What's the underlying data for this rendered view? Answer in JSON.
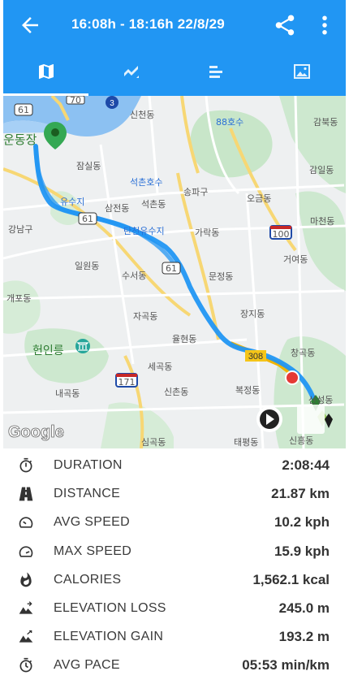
{
  "header": {
    "title": "16:08h - 18:16h  22/8/29",
    "icons": [
      "arrow-back-icon",
      "share-icon",
      "more-vert-icon"
    ]
  },
  "tabs": [
    {
      "icon": "map-icon",
      "active": true
    },
    {
      "icon": "chart-icon",
      "active": false
    },
    {
      "icon": "bars-icon",
      "active": false
    },
    {
      "icon": "photo-icon",
      "active": false
    }
  ],
  "map": {
    "labels": {
      "sincheon": "신천동",
      "lake88": "88호수",
      "gamun": "감북동",
      "undong": "운동장",
      "jamsil": "잠실동",
      "seokchon_lake": "석촌호수",
      "gamil": "감일동",
      "songpa": "송파구",
      "yusuji": "유수지",
      "samjeon": "삼전동",
      "seokchon": "석촌동",
      "ogeum": "오금동",
      "gangnam": "강남구",
      "tanjeon_yusuji": "탄천유수지",
      "garak": "가락동",
      "macheon": "마천동",
      "ilwon": "일원동",
      "suseo": "수서동",
      "geoyeo": "거여동",
      "munjeong": "문정동",
      "gaepo": "개포동",
      "jangji": "장지동",
      "jagok": "자곡동",
      "yulhyeon": "율현동",
      "heoninneung": "헌인릉",
      "changgok": "창곡동",
      "segok": "세곡동",
      "naegok": "내곡동",
      "sinchon": "신촌동",
      "bokjeong": "복정동",
      "sanseong": "산성동",
      "simgok": "심곡동",
      "taepyeong": "태평동",
      "sinheung": "신흥동",
      "shield_3": "3",
      "shield_70": "70",
      "shield_61a": "61",
      "shield_61b": "61",
      "shield_61c": "61",
      "shield_100": "100",
      "shield_308": "308",
      "shield_171": "171",
      "google": "Google"
    },
    "colors": {
      "route": "#2196f3",
      "end_marker": "#e53935",
      "start_pin": "#34a853"
    }
  },
  "stats": [
    {
      "icon": "stopwatch-icon",
      "label": "DURATION",
      "value": "2:08:44"
    },
    {
      "icon": "road-icon",
      "label": "DISTANCE",
      "value": "21.87 km"
    },
    {
      "icon": "speedometer-icon",
      "label": "AVG SPEED",
      "value": "10.2 kph"
    },
    {
      "icon": "speedometer-max-icon",
      "label": "MAX SPEED",
      "value": "15.9 kph"
    },
    {
      "icon": "flame-icon",
      "label": "CALORIES",
      "value": "1,562.1 kcal"
    },
    {
      "icon": "elevation-loss-icon",
      "label": "ELEVATION LOSS",
      "value": "245.0 m"
    },
    {
      "icon": "elevation-gain-icon",
      "label": "ELEVATION GAIN",
      "value": "193.2 m"
    },
    {
      "icon": "pace-icon",
      "label": "AVG PACE",
      "value": "05:53 min/km"
    }
  ]
}
